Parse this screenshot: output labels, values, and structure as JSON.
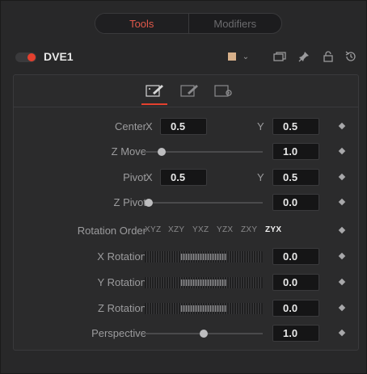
{
  "mode_tabs": {
    "tools": "Tools",
    "modifiers": "Modifiers"
  },
  "header": {
    "tool_name": "DVE1",
    "swatch_color": "#d7b08a",
    "icons": [
      "color-swatch-dropdown",
      "version-icon",
      "pin-icon",
      "lock-icon",
      "reset-icon"
    ]
  },
  "subtabs": [
    "controls-tab-icon",
    "mask-tab-icon",
    "settings-tab-icon"
  ],
  "controls": {
    "center": {
      "label": "Center",
      "x_axis": "X",
      "x": "0.5",
      "y_axis": "Y",
      "y": "0.5"
    },
    "z_move": {
      "label": "Z Move",
      "value": "1.0",
      "slider_fraction": 0.12
    },
    "pivot": {
      "label": "Pivot",
      "x_axis": "X",
      "x": "0.5",
      "y_axis": "Y",
      "y": "0.5"
    },
    "z_pivot": {
      "label": "Z Pivot",
      "value": "0.0",
      "slider_fraction": 0.0
    },
    "rotation_order": {
      "label": "Rotation Order",
      "options": [
        "XYZ",
        "XZY",
        "YXZ",
        "YZX",
        "ZXY",
        "ZYX"
      ],
      "selected": "ZYX"
    },
    "x_rotation": {
      "label": "X Rotation",
      "value": "0.0"
    },
    "y_rotation": {
      "label": "Y Rotation",
      "value": "0.0"
    },
    "z_rotation": {
      "label": "Z Rotation",
      "value": "0.0"
    },
    "perspective": {
      "label": "Perspective",
      "value": "1.0",
      "slider_fraction": 0.5
    }
  },
  "colors": {
    "accent": "#e4402e",
    "active_tab_text": "#e0584a"
  }
}
